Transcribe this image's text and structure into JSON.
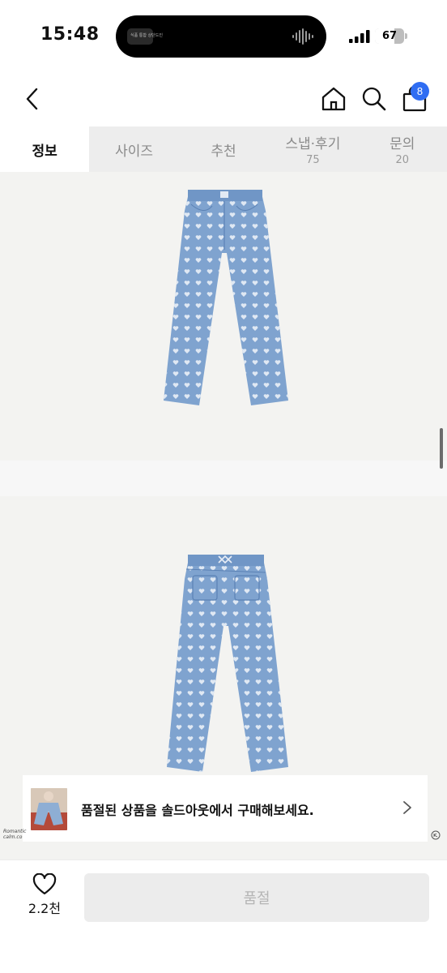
{
  "status_bar": {
    "time": "15:48",
    "island_text": "식품 통합 상단드인",
    "battery": "67",
    "battery_level": 0.67
  },
  "header": {
    "cart_count": "8"
  },
  "tabs": [
    {
      "label": "정보",
      "count": "",
      "active": true
    },
    {
      "label": "사이즈",
      "count": "",
      "active": false
    },
    {
      "label": "추천",
      "count": "",
      "active": false
    },
    {
      "label": "스냅·후기",
      "count": "75",
      "active": false
    },
    {
      "label": "문의",
      "count": "20",
      "active": false
    }
  ],
  "banner": {
    "text": "품절된 상품을 솔드아웃에서 구매해보세요."
  },
  "watermark": {
    "line1": "Romantic",
    "line2": "calm.co"
  },
  "bottom_bar": {
    "like_count": "2.2천",
    "soldout_label": "품절"
  },
  "colors": {
    "accent": "#2f6df2",
    "denim": "#7fa3cf",
    "tab_bg": "#ededed"
  },
  "icons": {
    "back": "chevron-left-icon",
    "home": "home-icon",
    "search": "search-icon",
    "bag": "shopping-bag-icon",
    "heart": "heart-icon",
    "chevron": "chevron-right-icon"
  }
}
